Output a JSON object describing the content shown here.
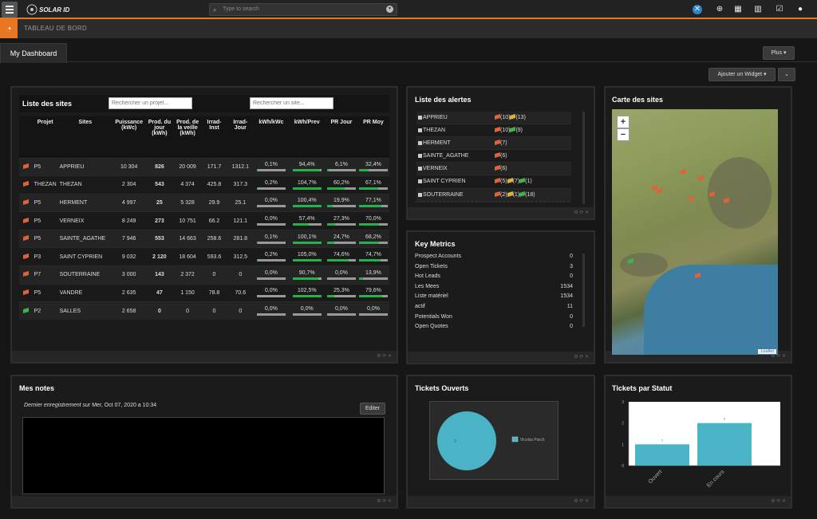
{
  "header": {
    "logo": "SOLAR ID",
    "search_placeholder": "Type to search",
    "icons": [
      "app-logo-icon",
      "plus-circle-icon",
      "calendar-icon",
      "bar-chart-icon",
      "checkbox-icon",
      "user-icon"
    ]
  },
  "breadcrumb": {
    "label": "TABLEAU DE BORD"
  },
  "tabs": {
    "active": "My Dashboard"
  },
  "buttons": {
    "plus": "Plus ▾",
    "add_widget": "Ajouter un Widget ▾",
    "caret": "⌄"
  },
  "sites_panel": {
    "title": "Liste des sites",
    "search_project_placeholder": "Rechercher un projet...",
    "search_site_placeholder": "Rechercher un site...",
    "columns": [
      "",
      "Projet",
      "Sites",
      "Puissance (kWc)",
      "Prod. du jour (kWh)",
      "Prod. de la veille (kWh)",
      "Irrad-Inst",
      "Irrad-Jour",
      "kWh/kWc",
      "kWh/Prev",
      "PR Jour",
      "PR Moy"
    ],
    "rows": [
      {
        "flag": "orange",
        "projet": "P5",
        "site": "APPRIEU",
        "puissance": "10 304",
        "prod_jour": "826",
        "prod_veille": "20 009",
        "irr_inst": "171.7",
        "irr_jour": "1312.1",
        "kwh_kwc": "0,1%",
        "kwh_prev": "94,4%",
        "pr_jour": "6,1%",
        "pr_moy": "32,4%",
        "b1": 0.01,
        "b2": 0.944,
        "b3": 0.061,
        "b4": 0.324
      },
      {
        "flag": "orange",
        "projet": "THEZAN",
        "site": "THEZAN",
        "puissance": "2 304",
        "prod_jour": "543",
        "prod_veille": "4 374",
        "irr_inst": "425.8",
        "irr_jour": "317.3",
        "kwh_kwc": "0,2%",
        "kwh_prev": "104,7%",
        "pr_jour": "60,2%",
        "pr_moy": "67,1%",
        "b1": 0.02,
        "b2": 1.0,
        "b3": 0.602,
        "b4": 0.671
      },
      {
        "flag": "orange",
        "projet": "P5",
        "site": "HERMENT",
        "puissance": "4 997",
        "prod_jour": "25",
        "prod_veille": "5 328",
        "irr_inst": "29.9",
        "irr_jour": "25.1",
        "kwh_kwc": "0,0%",
        "kwh_prev": "100,4%",
        "pr_jour": "19,9%",
        "pr_moy": "77,1%",
        "b1": 0.0,
        "b2": 1.0,
        "b3": 0.199,
        "b4": 0.771
      },
      {
        "flag": "orange",
        "projet": "P5",
        "site": "VERNEIX",
        "puissance": "8 249",
        "prod_jour": "273",
        "prod_veille": "10 751",
        "irr_inst": "66.2",
        "irr_jour": "121.1",
        "kwh_kwc": "0,0%",
        "kwh_prev": "57,4%",
        "pr_jour": "27,3%",
        "pr_moy": "70,0%",
        "b1": 0.0,
        "b2": 0.574,
        "b3": 0.273,
        "b4": 0.7
      },
      {
        "flag": "orange",
        "projet": "P5",
        "site": "SAINTE_AGATHE",
        "puissance": "7 946",
        "prod_jour": "553",
        "prod_veille": "14 663",
        "irr_inst": "258.6",
        "irr_jour": "281.8",
        "kwh_kwc": "0,1%",
        "kwh_prev": "100,1%",
        "pr_jour": "24,7%",
        "pr_moy": "68,2%",
        "b1": 0.01,
        "b2": 1.0,
        "b3": 0.247,
        "b4": 0.682
      },
      {
        "flag": "orange",
        "projet": "P3",
        "site": "SAINT CYPRIEN",
        "puissance": "9 032",
        "prod_jour": "2 120",
        "prod_veille": "18 604",
        "irr_inst": "593.6",
        "irr_jour": "312.5",
        "kwh_kwc": "0,2%",
        "kwh_prev": "105,0%",
        "pr_jour": "74,6%",
        "pr_moy": "74,7%",
        "b1": 0.02,
        "b2": 1.0,
        "b3": 0.746,
        "b4": 0.747
      },
      {
        "flag": "orange",
        "projet": "P7",
        "site": "SOUTERRAINE",
        "puissance": "3 000",
        "prod_jour": "143",
        "prod_veille": "2 372",
        "irr_inst": "0",
        "irr_jour": "0",
        "kwh_kwc": "0,0%",
        "kwh_prev": "90,7%",
        "pr_jour": "0,0%",
        "pr_moy": "13,9%",
        "b1": 0.0,
        "b2": 0.907,
        "b3": 0.0,
        "b4": 0.139
      },
      {
        "flag": "orange",
        "projet": "P5",
        "site": "VANDRE",
        "puissance": "2 635",
        "prod_jour": "47",
        "prod_veille": "1 150",
        "irr_inst": "78.8",
        "irr_jour": "70.6",
        "kwh_kwc": "0,0%",
        "kwh_prev": "102,5%",
        "pr_jour": "25,3%",
        "pr_moy": "79,6%",
        "b1": 0.0,
        "b2": 1.0,
        "b3": 0.253,
        "b4": 0.796
      },
      {
        "flag": "green",
        "projet": "P2",
        "site": "SALLES",
        "puissance": "2 658",
        "prod_jour": "0",
        "prod_veille": "0",
        "irr_inst": "0",
        "irr_jour": "0",
        "kwh_kwc": "0,0%",
        "kwh_prev": "0,0%",
        "pr_jour": "0,0%",
        "pr_moy": "0,0%",
        "b1": 0.0,
        "b2": 0.0,
        "b3": 0.0,
        "b4": 0.0
      }
    ]
  },
  "alerts_panel": {
    "title": "Liste des alertes",
    "rows": [
      {
        "name": "APPRIEU",
        "flags": [
          {
            "c": "orange",
            "t": "(10)"
          },
          {
            "c": "yellow",
            "t": "(13)"
          }
        ]
      },
      {
        "name": "THEZAN",
        "flags": [
          {
            "c": "orange",
            "t": "(10)"
          },
          {
            "c": "green",
            "t": "(9)"
          }
        ]
      },
      {
        "name": "HERMENT",
        "flags": [
          {
            "c": "orange",
            "t": "(7)"
          }
        ]
      },
      {
        "name": "SAINTE_AGATHE",
        "flags": [
          {
            "c": "orange",
            "t": "(6)"
          }
        ]
      },
      {
        "name": "VERNEIX",
        "flags": [
          {
            "c": "orange",
            "t": "(6)"
          }
        ]
      },
      {
        "name": "SAINT CYPRIEN",
        "flags": [
          {
            "c": "orange",
            "t": "(5)"
          },
          {
            "c": "yellow",
            "t": "(7)"
          },
          {
            "c": "green",
            "t": "(1)"
          }
        ]
      },
      {
        "name": "SOUTERRAINE",
        "flags": [
          {
            "c": "orange",
            "t": "(2)"
          },
          {
            "c": "yellow",
            "t": "(1)"
          },
          {
            "c": "green",
            "t": "(18)"
          }
        ]
      }
    ]
  },
  "metrics_panel": {
    "title": "Key Metrics",
    "rows": [
      {
        "label": "Prospect Accounts",
        "value": "0"
      },
      {
        "label": "Open Tickets",
        "value": "3"
      },
      {
        "label": "Hot Leads",
        "value": "0"
      },
      {
        "label": "Les Mees",
        "value": "1534"
      },
      {
        "label": "Liste matériel",
        "value": "1534"
      },
      {
        "label": "actif",
        "value": "11"
      },
      {
        "label": "Potentials Won",
        "value": "0"
      },
      {
        "label": "Open Quotes",
        "value": "0"
      }
    ]
  },
  "map_panel": {
    "title": "Carte des sites",
    "zoom_in": "+",
    "zoom_out": "−",
    "attribution": "Leaflet"
  },
  "notes_panel": {
    "title": "Mes notes",
    "saved_prefix": "Dernier enregistrement sur",
    "saved_date": "Mer, Oct 07, 2020 a 10:34",
    "edit": "Editer"
  },
  "tickets_open_panel": {
    "title": "Tickets Ouverts"
  },
  "tickets_status_panel": {
    "title": "Tickets par Statut"
  },
  "chart_data": [
    {
      "type": "pie",
      "values": [
        3
      ],
      "labels": [
        "3"
      ],
      "legend": [
        "Vicolas Parch"
      ],
      "colors": [
        "#4ab3c6"
      ]
    },
    {
      "type": "bar",
      "categories": [
        "Ouvert",
        "En cours"
      ],
      "values": [
        1,
        2
      ],
      "ylim": [
        0,
        3
      ],
      "yticks": [
        "0",
        "1",
        "2",
        "3"
      ],
      "colors": [
        "#4ab3c6"
      ]
    }
  ],
  "footer_icons": "⚙ ⟳ ✕"
}
